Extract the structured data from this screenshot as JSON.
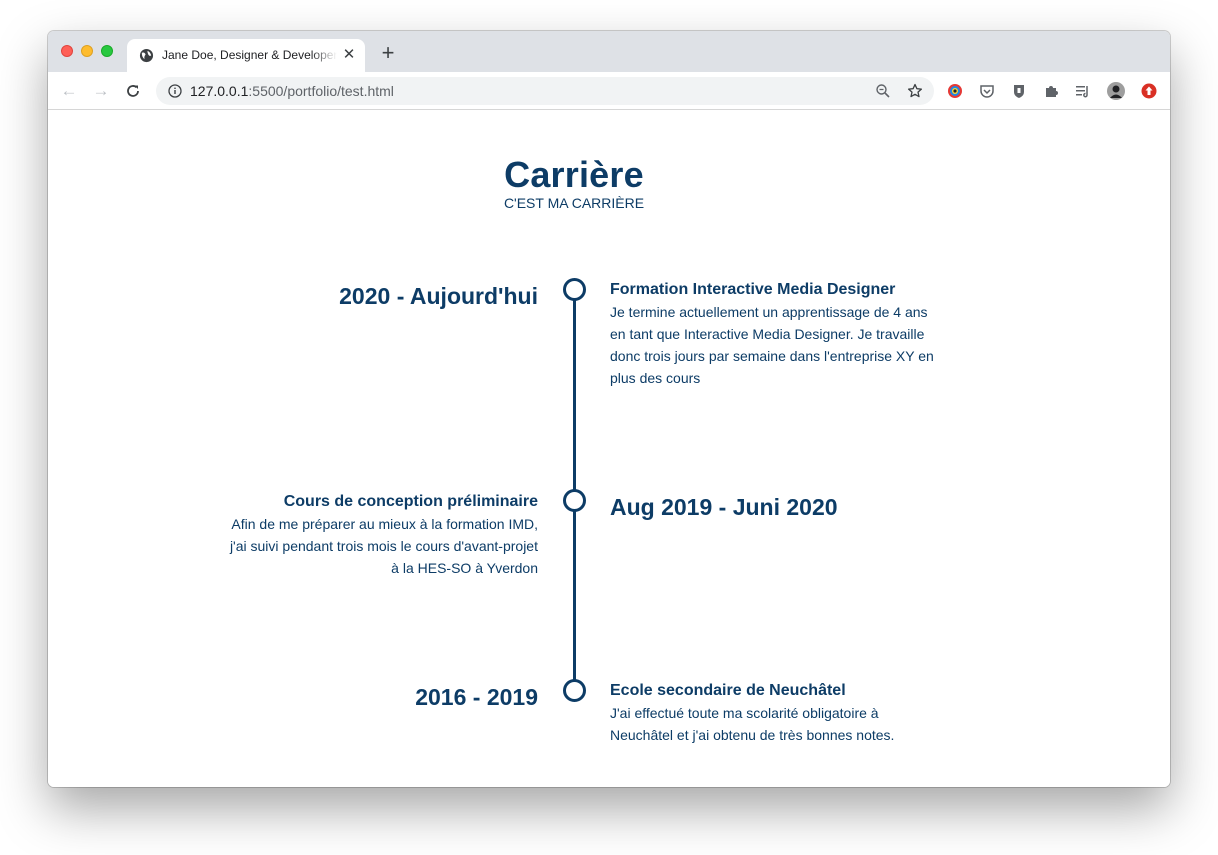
{
  "browser": {
    "tab_title": "Jane Doe, Designer & Developer",
    "close_glyph": "✕",
    "new_tab_glyph": "+",
    "url_host": "127.0.0.1",
    "url_path": ":5500/portfolio/test.html",
    "nav": {
      "back": "←",
      "forward": "→",
      "reload": "C"
    }
  },
  "page": {
    "title": "Carrière",
    "subtitle": "C'EST MA CARRIÈRE",
    "timeline": [
      {
        "date": "2020 - Aujourd'hui",
        "title": "Formation Interactive Media Designer",
        "description": "Je termine actuellement un apprentissage de 4 ans en tant que Interactive Media Designer. Je travaille donc trois jours par semaine dans l'entreprise XY en plus des cours"
      },
      {
        "date": "Aug 2019 - Juni 2020",
        "title": "Cours de conception préliminaire",
        "description": "Afin de me préparer au mieux à la formation IMD, j'ai suivi pendant trois mois le cours d'avant-projet à la HES-SO à Yverdon"
      },
      {
        "date": "2016 - 2019",
        "title": "Ecole secondaire de Neuchâtel",
        "description": "J'ai effectué toute ma scolarité obligatoire à Neuchâtel et j'ai obtenu de très bonnes notes."
      }
    ]
  },
  "colors": {
    "accent": "#0d3c66",
    "tabstrip": "#dee1e6",
    "omnibox": "#f1f3f4"
  }
}
